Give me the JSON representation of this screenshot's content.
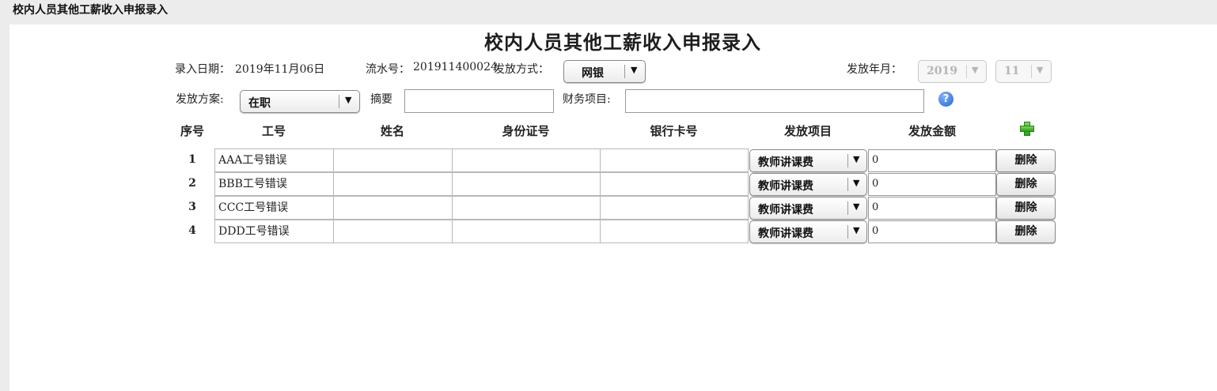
{
  "window": {
    "title": "校内人员其他工薪收入申报录入"
  },
  "header": {
    "title": "校内人员其他工薪收入申报录入"
  },
  "form": {
    "entry_date_label": "录入日期：",
    "entry_date_value": "2019年11月06日",
    "serial_label": "流水号：",
    "serial_value": "201911400024",
    "pay_method_label": "发放方式：",
    "pay_method_value": "网银",
    "pay_period_label": "发放年月：",
    "pay_year_value": "2019",
    "pay_month_value": "11",
    "plan_label": "发放方案:",
    "plan_value": "在职",
    "summary_label": "摘要",
    "summary_value": "",
    "finance_label": "财务项目:",
    "finance_value": ""
  },
  "table": {
    "headers": [
      "序号",
      "工号",
      "姓名",
      "身份证号",
      "银行卡号",
      "发放项目",
      "发放金额"
    ],
    "delete_label": "删除",
    "rows": [
      {
        "seq": "1",
        "emp_id": "AAA工号错误",
        "name": "",
        "id_no": "",
        "card_no": "",
        "item": "教师讲课费",
        "amount": "0"
      },
      {
        "seq": "2",
        "emp_id": "BBB工号错误",
        "name": "",
        "id_no": "",
        "card_no": "",
        "item": "教师讲课费",
        "amount": "0"
      },
      {
        "seq": "3",
        "emp_id": "CCC工号错误",
        "name": "",
        "id_no": "",
        "card_no": "",
        "item": "教师讲课费",
        "amount": "0"
      },
      {
        "seq": "4",
        "emp_id": "DDD工号错误",
        "name": "",
        "id_no": "",
        "card_no": "",
        "item": "教师讲课费",
        "amount": "0"
      }
    ]
  },
  "icons": {
    "help": "help-icon",
    "add": "plus-icon",
    "dropdown": "chevron-down-icon"
  },
  "colors": {
    "help_blue": "#2a66c9",
    "add_green": "#2f9e1f"
  }
}
